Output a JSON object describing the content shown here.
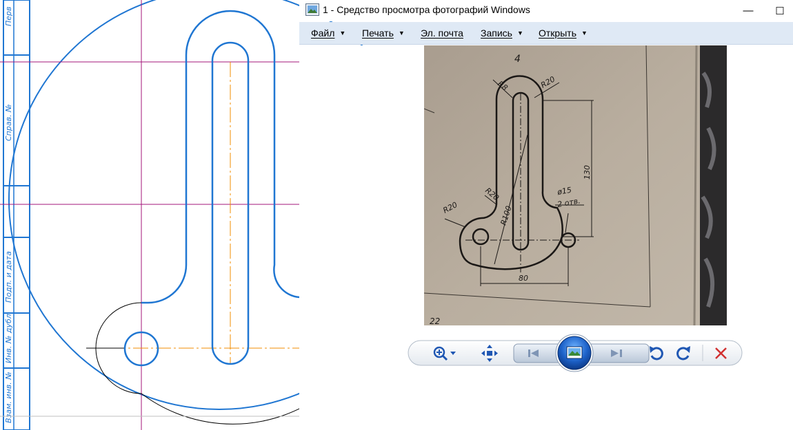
{
  "window": {
    "title": "1 - Средство просмотра фотографий Windows",
    "minimize_glyph": "—",
    "maximize_glyph": "☐"
  },
  "menu": {
    "items": [
      {
        "label": "Файл",
        "has_arrow": true
      },
      {
        "label": "Печать",
        "has_arrow": true
      },
      {
        "label": "Эл. почта",
        "has_arrow": false
      },
      {
        "label": "Запись",
        "has_arrow": true
      },
      {
        "label": "Открыть",
        "has_arrow": true
      }
    ],
    "arrow_glyph": "▼"
  },
  "drawing_stamp": {
    "labels": [
      "Перв",
      "Справ. №",
      "Подп. и дата",
      "Инв. № дубл.",
      "Взам. инв. №"
    ]
  },
  "photo": {
    "page_number": "4",
    "bottom_label": "22",
    "dims": {
      "r8": "R8",
      "r20_top": "R20",
      "height": "130",
      "r20_mid": "R20",
      "r100": "R100",
      "r20_left": "R20",
      "hole_dia": "ø15",
      "hole_count": "2 отв.",
      "width": "80"
    }
  },
  "controls": {
    "icons": [
      "zoom-icon",
      "fit-to-window-icon",
      "previous-icon",
      "slideshow-icon",
      "next-icon",
      "rotate-counterclockwise-icon",
      "rotate-clockwise-icon",
      "delete-icon"
    ],
    "colors": {
      "blue": "#1f57b3",
      "delete_red": "#d13030"
    }
  },
  "colors": {
    "cad_blue": "#1f76d2",
    "cad_magenta": "#a3157a",
    "cad_orange": "#f08c00",
    "menubar": "#dfe9f5",
    "photo_paper": "#b5aa9c"
  }
}
